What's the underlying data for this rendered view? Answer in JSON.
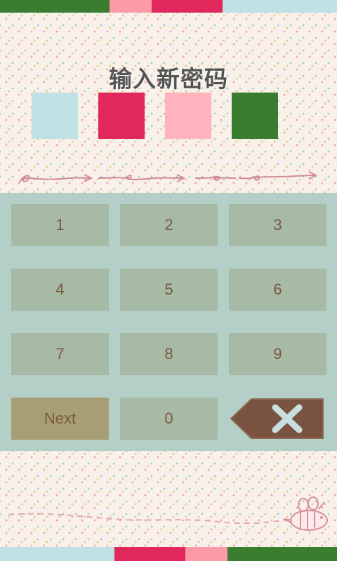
{
  "title": "输入新密码",
  "colors": {
    "dark_green": "#3a7d31",
    "pink": "#fd9aa8",
    "crimson": "#e0285c",
    "light_blue": "#bfe1e3",
    "keypad_bg": "#b3cfc7",
    "key_bg": "#a6baa5",
    "next_bg": "#a89e74",
    "key_text": "#7a5a40",
    "delete_bg": "#7a5340"
  },
  "pin_slots": [
    {
      "color": "#bfe1e3"
    },
    {
      "color": "#e0285c"
    },
    {
      "color": "#ffb3bd"
    },
    {
      "color": "#3a7d31"
    }
  ],
  "keypad": {
    "keys": [
      "1",
      "2",
      "3",
      "4",
      "5",
      "6",
      "7",
      "8",
      "9"
    ],
    "next_label": "Next",
    "zero_label": "0",
    "delete_icon": "backspace-x-icon"
  }
}
